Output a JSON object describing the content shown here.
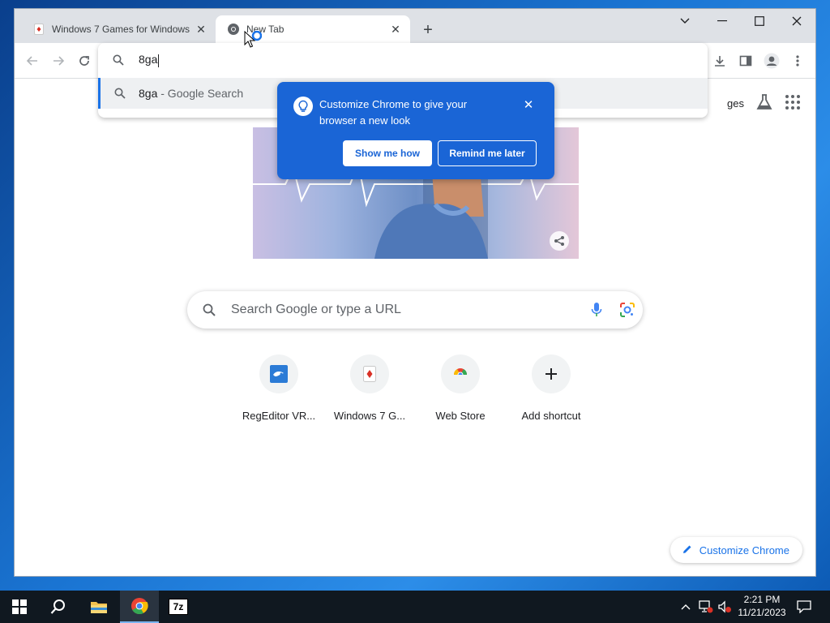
{
  "browser": {
    "tabs": [
      {
        "title": "Windows 7 Games for Windows"
      },
      {
        "title": "New Tab"
      }
    ]
  },
  "omnibox": {
    "typed": "8ga",
    "suggestion": {
      "query": "8ga",
      "suffix": " - Google Search"
    }
  },
  "iph": {
    "message": "Customize Chrome to give your browser a new look",
    "primary": "Show me how",
    "secondary": "Remind me later"
  },
  "ntp": {
    "top_link_partial": "ges",
    "search_placeholder": "Search Google or type a URL",
    "shortcuts": [
      {
        "label": "RegEditor VR..."
      },
      {
        "label": "Windows 7 G..."
      },
      {
        "label": "Web Store"
      },
      {
        "label": "Add shortcut"
      }
    ],
    "customize_label": "Customize Chrome"
  },
  "taskbar": {
    "time": "2:21 PM",
    "date": "11/21/2023",
    "zip_label": "7z"
  },
  "colors": {
    "accent": "#1a73e8",
    "iph_bg": "#1a65d6",
    "taskbar": "#101820"
  }
}
